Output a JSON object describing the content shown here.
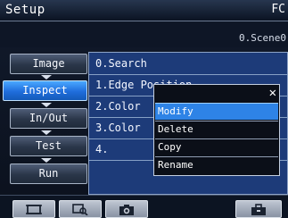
{
  "header": {
    "title": "Setup",
    "right_text": "FC"
  },
  "scene_label": "0.Scene0",
  "sidebar": {
    "items": [
      {
        "label": "Image",
        "active": false
      },
      {
        "label": "Inspect",
        "active": true
      },
      {
        "label": "In/Out",
        "active": false
      },
      {
        "label": "Test",
        "active": false
      },
      {
        "label": "Run",
        "active": false
      }
    ]
  },
  "flow": {
    "items": [
      "0.Search",
      "1.Edge Position",
      "2.Color",
      "3.Color",
      "4."
    ]
  },
  "context_menu": {
    "close_symbol": "✕",
    "items": [
      "Modify",
      "Delete",
      "Copy",
      "Rename"
    ],
    "selected_index": 0
  },
  "toolbar": {
    "icons": [
      "window-icon",
      "zoom-icon",
      "camera-icon",
      "toolbox-icon"
    ]
  },
  "colors": {
    "panel_blue": "#1d3b79",
    "active_blue": "#2e83e6",
    "sidebar_active": "#1f6ddc"
  }
}
